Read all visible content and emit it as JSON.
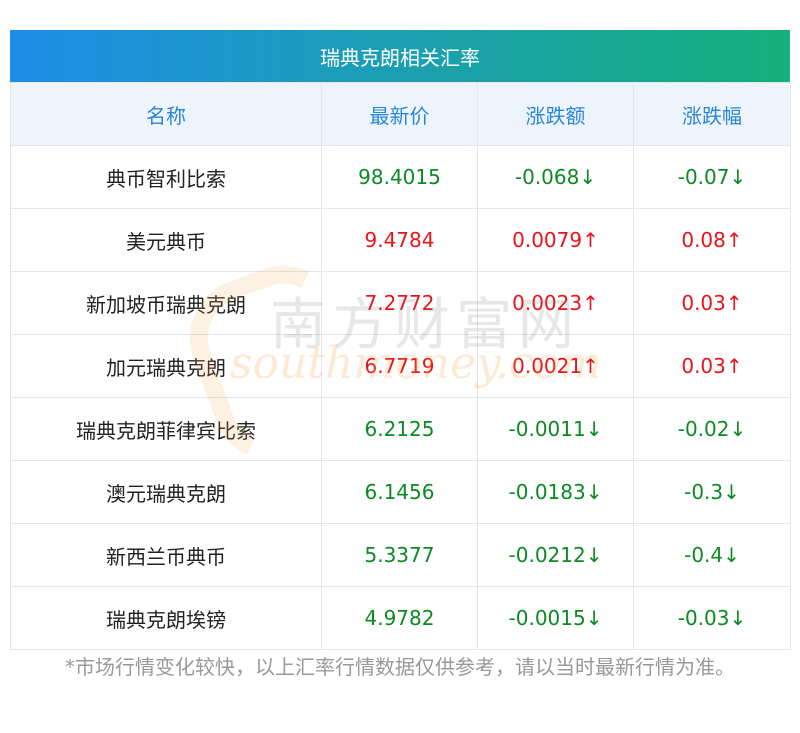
{
  "title": "瑞典克朗相关汇率",
  "headers": [
    "名称",
    "最新价",
    "涨跌额",
    "涨跌幅"
  ],
  "rows": [
    {
      "name": "典币智利比索",
      "price": "98.4015",
      "change": "-0.068↓",
      "pct": "-0.07↓",
      "trend": "down"
    },
    {
      "name": "美元典币",
      "price": "9.4784",
      "change": "0.0079↑",
      "pct": "0.08↑",
      "trend": "up"
    },
    {
      "name": "新加坡币瑞典克朗",
      "price": "7.2772",
      "change": "0.0023↑",
      "pct": "0.03↑",
      "trend": "up"
    },
    {
      "name": "加元瑞典克朗",
      "price": "6.7719",
      "change": "0.0021↑",
      "pct": "0.03↑",
      "trend": "up"
    },
    {
      "name": "瑞典克朗菲律宾比索",
      "price": "6.2125",
      "change": "-0.0011↓",
      "pct": "-0.02↓",
      "trend": "down"
    },
    {
      "name": "澳元瑞典克朗",
      "price": "6.1456",
      "change": "-0.0183↓",
      "pct": "-0.3↓",
      "trend": "down"
    },
    {
      "name": "新西兰币典币",
      "price": "5.3377",
      "change": "-0.0212↓",
      "pct": "-0.4↓",
      "trend": "down"
    },
    {
      "name": "瑞典克朗埃镑",
      "price": "4.9782",
      "change": "-0.0015↓",
      "pct": "-0.03↓",
      "trend": "down"
    }
  ],
  "watermark": {
    "cn": "南方财富网",
    "en": "southmoney.com"
  },
  "footnote": "*市场行情变化较快，以上汇率行情数据仅供参考，请以当时最新行情为准。",
  "colors": {
    "up": "#e8141b",
    "down": "#0d8a23",
    "header_text": "#2a86d9",
    "title_gradient_start": "#1e8ee8",
    "title_gradient_end": "#16b07a"
  }
}
